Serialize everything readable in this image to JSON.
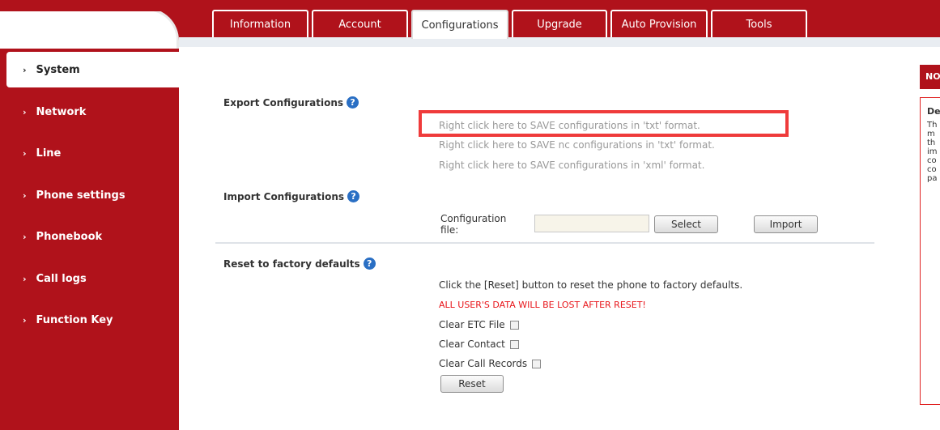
{
  "tabs": [
    {
      "label": "Information"
    },
    {
      "label": "Account"
    },
    {
      "label": "Configurations"
    },
    {
      "label": "Upgrade"
    },
    {
      "label": "Auto Provision"
    },
    {
      "label": "Tools"
    }
  ],
  "sidebar": {
    "items": [
      {
        "label": "System"
      },
      {
        "label": "Network"
      },
      {
        "label": "Line"
      },
      {
        "label": "Phone settings"
      },
      {
        "label": "Phonebook"
      },
      {
        "label": "Call logs"
      },
      {
        "label": "Function Key"
      }
    ]
  },
  "export": {
    "title": "Export Configurations",
    "links": [
      "Right click here to SAVE configurations in 'txt' format.",
      "Right click here to SAVE nc configurations in 'txt' format.",
      "Right click here to SAVE configurations in 'xml' format."
    ]
  },
  "import": {
    "title": "Import Configurations",
    "file_label": "Configuration file:",
    "file_value": "",
    "select_label": "Select",
    "import_label": "Import"
  },
  "reset": {
    "title": "Reset to factory defaults",
    "description": "Click the [Reset] button to reset the phone to factory defaults.",
    "warning": "ALL USER'S DATA WILL BE LOST AFTER RESET!",
    "options": [
      {
        "label": "Clear ETC File",
        "checked": false
      },
      {
        "label": "Clear Contact",
        "checked": false
      },
      {
        "label": "Clear Call Records",
        "checked": false
      }
    ],
    "button_label": "Reset"
  },
  "note": {
    "header": "NO",
    "title": "De",
    "lines": [
      "Th",
      "m",
      "th",
      "im",
      "co",
      "co",
      "pa"
    ]
  },
  "help_glyph": "?",
  "nav_arrow_glyph": "›",
  "colors": {
    "brand_red": "#b0121b",
    "warning_red": "#e8161b",
    "help_blue": "#2a6fc4",
    "highlight_red": "#ef3b3b"
  }
}
